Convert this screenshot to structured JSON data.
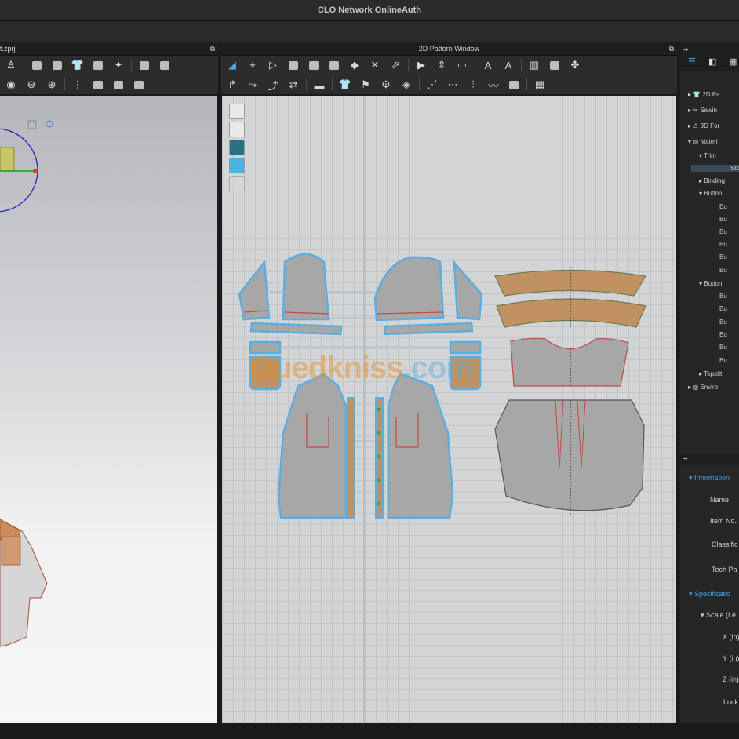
{
  "app": {
    "title": "CLO Network OnlineAuth"
  },
  "left_window": {
    "title": "t.zprj"
  },
  "pattern_window": {
    "title": "2D Pattern Window"
  },
  "object_browser": {
    "items": [
      {
        "label": "2D Pa",
        "icon": "pattern-icon"
      },
      {
        "label": "Sewin",
        "icon": "sewing-icon"
      },
      {
        "label": "3D For",
        "icon": "avatar-icon"
      },
      {
        "label": "Materi",
        "icon": "material-icon"
      },
      {
        "label": "Trim"
      },
      {
        "label": "Sto"
      },
      {
        "label": "Binding"
      },
      {
        "label": "Button"
      },
      {
        "label": "Bu"
      },
      {
        "label": "Bu"
      },
      {
        "label": "Bu"
      },
      {
        "label": "Bu"
      },
      {
        "label": "Bu"
      },
      {
        "label": "Bu"
      },
      {
        "label": "Button"
      },
      {
        "label": "Bu"
      },
      {
        "label": "Bu"
      },
      {
        "label": "Bu"
      },
      {
        "label": "Bu"
      },
      {
        "label": "Bu"
      },
      {
        "label": "Bu"
      },
      {
        "label": "Topstit"
      },
      {
        "label": "Enviro",
        "icon": "environment-icon"
      }
    ]
  },
  "property_editor": {
    "information_header": "Information",
    "info_fields": [
      "Name",
      "Item No.",
      "Classific",
      "Tech Pa"
    ],
    "specification_header": "Specificatio",
    "scale_label": "Scale (Le",
    "spec_fields": [
      "X (in)",
      "Y (in)",
      "Z (in)",
      "Lock"
    ]
  },
  "watermark": {
    "main": "Ouedkniss",
    "suffix": ".com"
  },
  "colors": {
    "accent": "#3fa8e8",
    "pattern_piece": "#a7a7a7",
    "pattern_outline": "#5aaee0",
    "collar_fill": "#c09262",
    "gizmo": "#2d22c0"
  }
}
